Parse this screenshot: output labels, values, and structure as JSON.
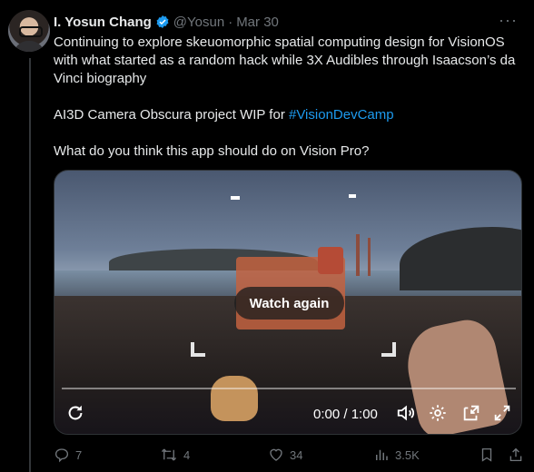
{
  "author": {
    "name": "I. Yosun Chang",
    "handle": "@Yosun",
    "separator": "·",
    "date": "Mar 30"
  },
  "tweet": {
    "line1": "Continuing to explore skeuomorphic spatial computing design for VisionOS with what started as a random hack while 3X Audibles through Isaacson’s da Vinci biography",
    "line2_prefix": "AI3D Camera Obscura project WIP for ",
    "hashtag": "#VisionDevCamp",
    "line3": "What do you think this app should do on Vision Pro?"
  },
  "video": {
    "overlay_button": "Watch again",
    "time": "0:00 / 1:00",
    "progress_fraction": 0
  },
  "actions": {
    "replies": "7",
    "retweets": "4",
    "likes": "34",
    "views": "3.5K"
  },
  "icons": {
    "verified": "verified-badge-icon",
    "more": "more-dots-icon",
    "replay": "replay-icon",
    "volume": "volume-icon",
    "settings": "gear-icon",
    "pip": "picture-in-picture-icon",
    "fullscreen": "fullscreen-icon",
    "reply": "reply-icon",
    "retweet": "retweet-icon",
    "like": "heart-icon",
    "views": "views-chart-icon",
    "bookmark": "bookmark-icon",
    "share": "share-icon"
  },
  "colors": {
    "accent": "#1d9bf0",
    "muted": "#71767b",
    "background": "#000000"
  }
}
